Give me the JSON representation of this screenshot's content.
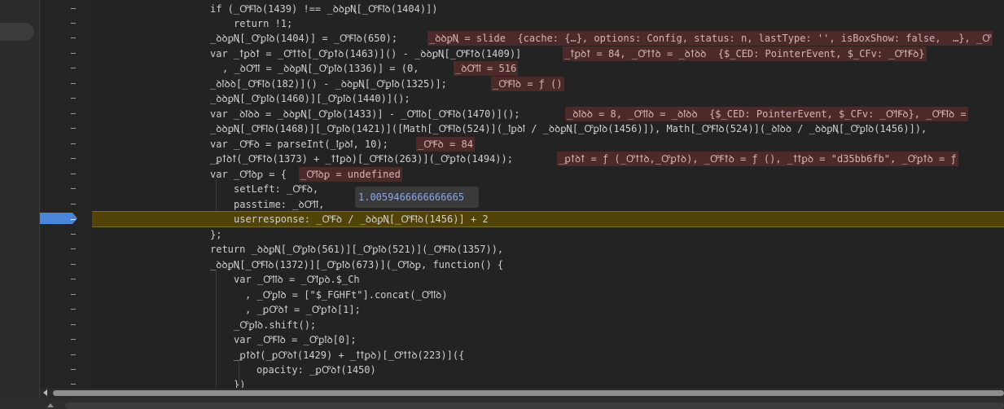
{
  "editor": {
    "tooltip": "1.0059466666666665",
    "lines": [
      {
        "text": "if (_ꝌꞘꝉꝺ(1439) !== _ꝺꝺꝑꞐ[_ꝌꞘꝉꝺ(1404)])"
      },
      {
        "text": "return !1;"
      },
      {
        "text": "_ꝺꝺꝑꞐ[_Ꝍꝑꝉꝺ(1404)] = _ꝌꞘꝉꝺ(650);",
        "eval": "_ꝺꝺꝑꞐ = slide  {cache: {…}, options: Config, status: n, lastType: '', isBoxShow: false,  …}, _Ꝍ"
      },
      {
        "text": "var _ꝉꝑꝺꝉ = _Ꝍꝉꝉꝺ[_Ꝍꝑꝉꝺ(1463)]() - _ꝺꝺꝑꞐ[_ꝌꞘꝉꝺ(1409)]",
        "eval": "_ꝉꝑꝺꝉ = 84, _Ꝍꝉꝉꝺ = _ꝺꝉꝺꝺ  {$_CED: PointerEvent, $_CFv: _ꝌꝉꞘꝺ}"
      },
      {
        "text": ", _ꝺꝌꝉꝉ = _ꝺꝺꝑꞐ[_Ꝍꝑꝉꝺ(1336)] = (0,",
        "eval": "_ꝺꝌꝉꝉ = 516"
      },
      {
        "text": "_ꝺꝉꝺꝺ[_ꝌꞘꝉꝺ(182)]() - _ꝺꝺꝑꞐ[_Ꝍꝑꝉꝺ(1325)];",
        "eval": "_ꝌꞘꝉꝺ = ƒ ()"
      },
      {
        "text": "_ꝺꝺꝑꞐ[_Ꝍꝑꝉꝺ(1460)][_Ꝍꝑꝉꝺ(1440)]();"
      },
      {
        "text": "var _ꝺꝉꝺꝺ = _ꝺꝺꝑꞐ[_Ꝍꝑꝉꝺ(1433)] - _Ꝍꝉꝉꝺ[_ꝌꞘꝉꝺ(1470)]();",
        "eval": "_ꝺꝉꝺꝺ = 8, _Ꝍꝉꝉꝺ = _ꝺꝉꝺꝺ  {$_CED: PointerEvent, $_CFv: _ꝌꝉꞘꝺ}, _ꝌꞘꝉꝺ ="
      },
      {
        "text": "_ꝺꝺꝑꞐ[_ꝌꞘꝉꝺ(1468)][_Ꝍꝑꝉꝺ(1421)]([Math[_ꝌꞘꝉꝺ(524)](_ꝉꝑꝺꝉ / _ꝺꝺꝑꞐ[_Ꝍꝑꝉꝺ(1456)]), Math[_ꝌꞘꝉꝺ(524)](_ꝺꝉꝺꝺ / _ꝺꝺꝑꞐ[_Ꝍꝑꝉꝺ(1456)]),"
      },
      {
        "text": "var _ꝌꞘꝺ = parseInt(_ꝉꝑꝺꝉ, 10);",
        "eval": "_ꝌꞘꝺ = 84"
      },
      {
        "text": "_ꝑꝉꝺꝉ(_ꝌꞘꝉꝺ(1373) + _ꝉꝉꝑꝺ)[_ꝌꞘꝉꝺ(263)](_Ꝍꝑꝉꝺ(1494));",
        "eval": "_ꝑꝉꝺꝉ = ƒ (_Ꝍꝉꝉꝺ,_Ꝍꝑꝉꝺ), _ꝌꞘꝉꝺ = ƒ (), _ꝉꝉꝑꝺ = \"d35bb6fb\", _Ꝍꝑꝉꝺ = ƒ"
      },
      {
        "text": "var _Ꝍꝉꝺꝑ = {",
        "eval": "_Ꝍꝉꝺꝑ = undefined"
      },
      {
        "text": "setLeft: _ꝌꞘꝺ,"
      },
      {
        "text": "passtime: _ꝺꝌꝉꝉ,"
      },
      {
        "text": "userresponse: _ꝌꞘꝺ / _ꝺꝺꝑꞐ[_ꝌꞘꝉꝺ(1456)] + 2"
      },
      {
        "text": "};"
      },
      {
        "text": "return _ꝺꝺꝑꞐ[_Ꝍꝑꝉꝺ(561)][_Ꝍꝑꝉꝺ(521)](_ꝌꞘꝉꝺ(1357)),"
      },
      {
        "text": "_ꝺꝺꝑꞐ[_ꝌꞘꝉꝺ(1372)][_Ꝍꝑꝉꝺ(673)](_Ꝍꝉꝺꝑ, function() {"
      },
      {
        "text": "var _Ꝍꝉꝉꝺ = _Ꝍꝉꝑꝺ.$_Ch"
      },
      {
        "text": ", _Ꝍꝑꝉꝺ = [\"$_FGHFt\"].concat(_Ꝍꝉꝉꝺ)"
      },
      {
        "text": ", _ꝑꝌꝺꝉ = _Ꝍꝑꝉꝺ[1];"
      },
      {
        "text": "_Ꝍꝑꝉꝺ.shift();"
      },
      {
        "text": "var _ꝌꞘꝉꝺ = _Ꝍꝑꝉꝺ[0];"
      },
      {
        "text": "_ꝑꝉꝺꝉ(_ꝑꝌꝺꝉ(1429) + _ꝉꝉꝑꝺ)[_Ꝍꝉꝉꝺ(223)]({"
      },
      {
        "text": "opacity: _ꝑꝌꝺꝉ(1450)"
      },
      {
        "text": "})"
      }
    ]
  }
}
